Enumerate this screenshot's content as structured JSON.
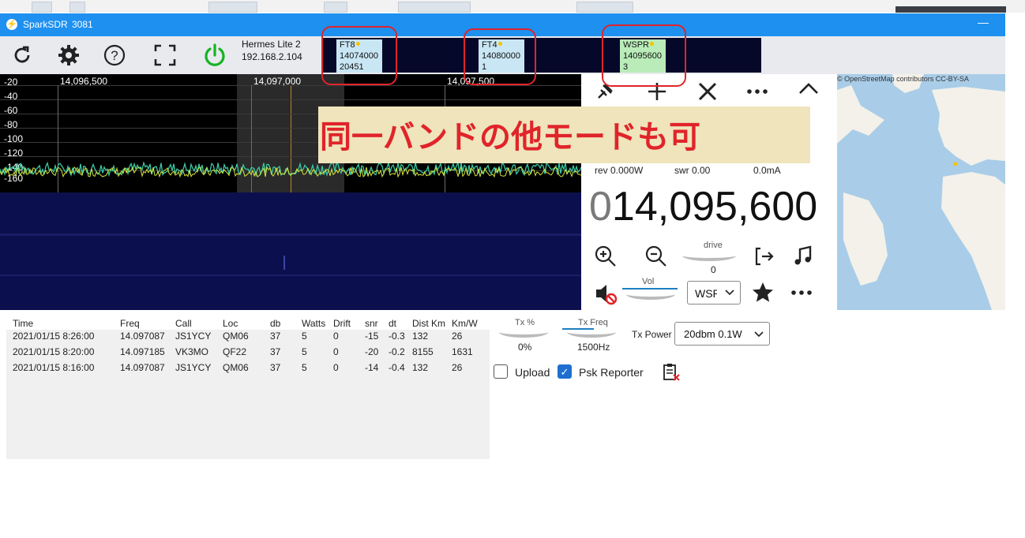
{
  "window": {
    "title": "SparkSDR",
    "port": "3081",
    "minimize_glyph": "—"
  },
  "device": {
    "name": "Hermes Lite 2",
    "ip": "192.168.2.104"
  },
  "toolbar": {
    "icons": [
      "refresh-icon",
      "gear-icon",
      "help-icon",
      "fullscreen-icon",
      "power-icon"
    ]
  },
  "receivers": [
    {
      "mode": "FT8",
      "freq": "14074000",
      "count": "20451",
      "color": "#c9e6f4"
    },
    {
      "mode": "FT4",
      "freq": "14080000",
      "count": "1",
      "color": "#c9e6f4"
    },
    {
      "mode": "WSPR",
      "freq": "14095600",
      "count": "3",
      "color": "#b9ecb8"
    }
  ],
  "spectrum": {
    "db_labels": [
      "-20",
      "-40",
      "-60",
      "-80",
      "-100",
      "-120",
      "-140",
      "-160"
    ],
    "freq_labels": [
      "14,096,500",
      "14,097,000",
      "14,097,500"
    ]
  },
  "control": {
    "rev": "rev 0.000W",
    "swr": "swr 0.00",
    "current": "0.0mA",
    "freq_lead": "0",
    "freq_main": "14,095,600",
    "drive_label": "drive",
    "drive_value": "0",
    "vol_label": "Vol",
    "mode_select": "WSPR"
  },
  "map": {
    "attribution": "© OpenStreetMap contributors CC-BY-SA"
  },
  "annotation": {
    "text": "同一バンドの他モードも可"
  },
  "table": {
    "headers": [
      "Time",
      "Freq",
      "Call",
      "Loc",
      "db",
      "Watts",
      "Drift",
      "snr",
      "dt",
      "Dist Km",
      "Km/W"
    ],
    "rows": [
      [
        "2021/01/15 8:26:00",
        "14.097087",
        "JS1YCY",
        "QM06",
        "37",
        "5",
        "0",
        "-15",
        "-0.3",
        "132",
        "26"
      ],
      [
        "2021/01/15 8:20:00",
        "14.097185",
        "VK3MO",
        "QF22",
        "37",
        "5",
        "0",
        "-20",
        "-0.2",
        "8155",
        "1631"
      ],
      [
        "2021/01/15 8:16:00",
        "14.097087",
        "JS1YCY",
        "QM06",
        "37",
        "5",
        "0",
        "-14",
        "-0.4",
        "132",
        "26"
      ]
    ]
  },
  "tx": {
    "tx_pct_label": "Tx %",
    "tx_pct_value": "0%",
    "tx_freq_label": "Tx Freq",
    "tx_freq_value": "1500Hz",
    "tx_power_label": "Tx Power",
    "tx_power_value": "20dbm 0.1W",
    "upload_label": "Upload",
    "upload_checked": false,
    "psk_label": "Psk Reporter",
    "psk_checked": true
  }
}
